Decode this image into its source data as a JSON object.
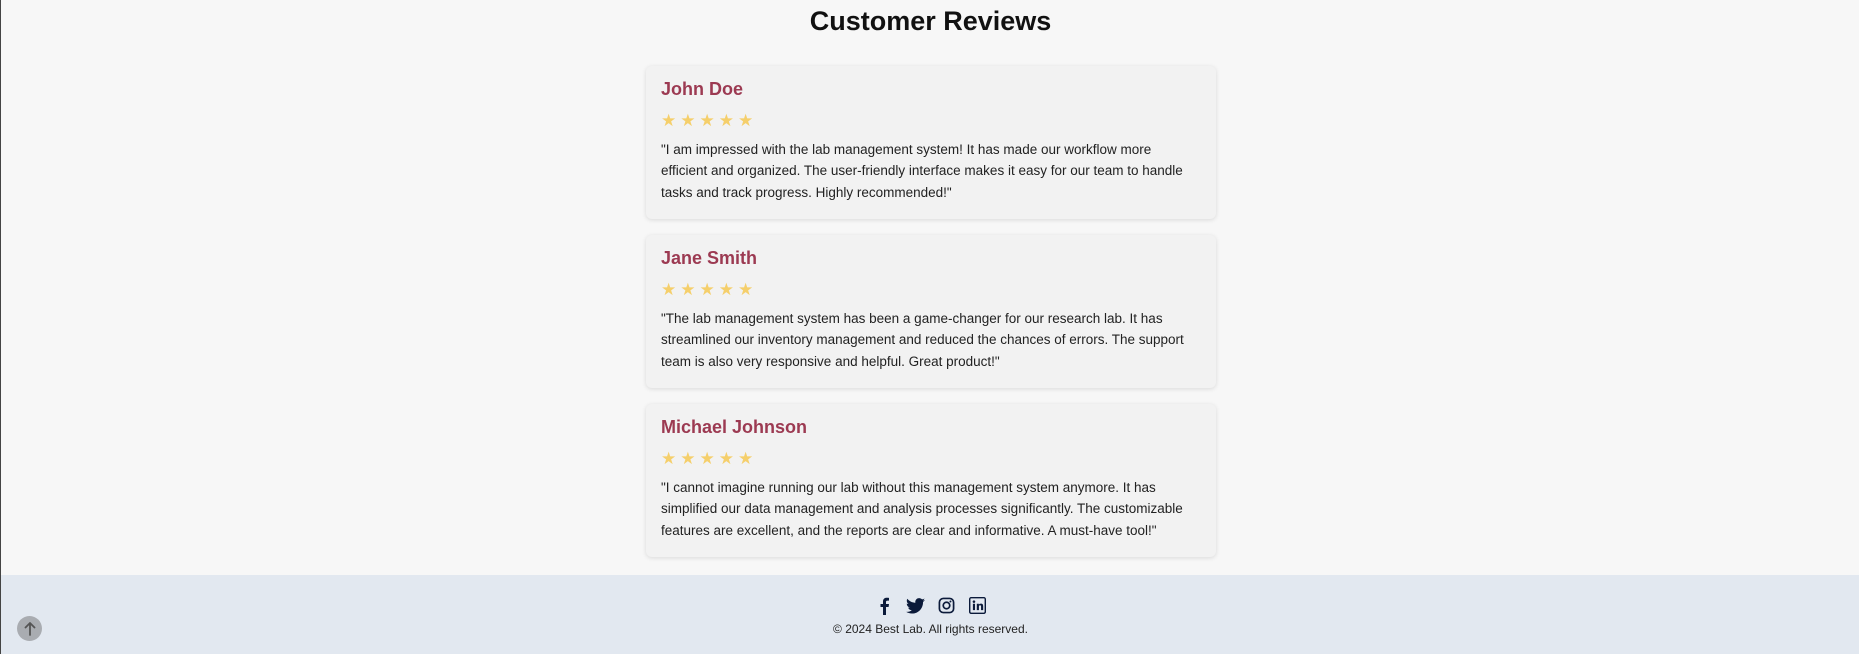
{
  "page": {
    "title": "Customer Reviews"
  },
  "reviews": [
    {
      "name": "John Doe",
      "rating": 5,
      "stars": "★★★★★",
      "text": "\"I am impressed with the lab management system! It has made our workflow more efficient and organized. The user-friendly interface makes it easy for our team to handle tasks and track progress. Highly recommended!\""
    },
    {
      "name": "Jane Smith",
      "rating": 5,
      "stars": "★★★★★",
      "text": "\"The lab management system has been a game-changer for our research lab. It has streamlined our inventory management and reduced the chances of errors. The support team is also very responsive and helpful. Great product!\""
    },
    {
      "name": "Michael Johnson",
      "rating": 5,
      "stars": "★★★★★",
      "text": "\"I cannot imagine running our lab without this management system anymore. It has simplified our data management and analysis processes significantly. The customizable features are excellent, and the reports are clear and informative. A must-have tool!\""
    }
  ],
  "footer": {
    "social_icons": [
      "facebook-icon",
      "twitter-icon",
      "instagram-icon",
      "linkedin-icon"
    ],
    "copyright": "© 2024 Best Lab. All rights reserved."
  },
  "colors": {
    "reviewer_name": "#9c3a52",
    "stars": "#f5cf6b",
    "footer_bg": "#e2e8f0",
    "icon_color": "#0b1a3a"
  }
}
